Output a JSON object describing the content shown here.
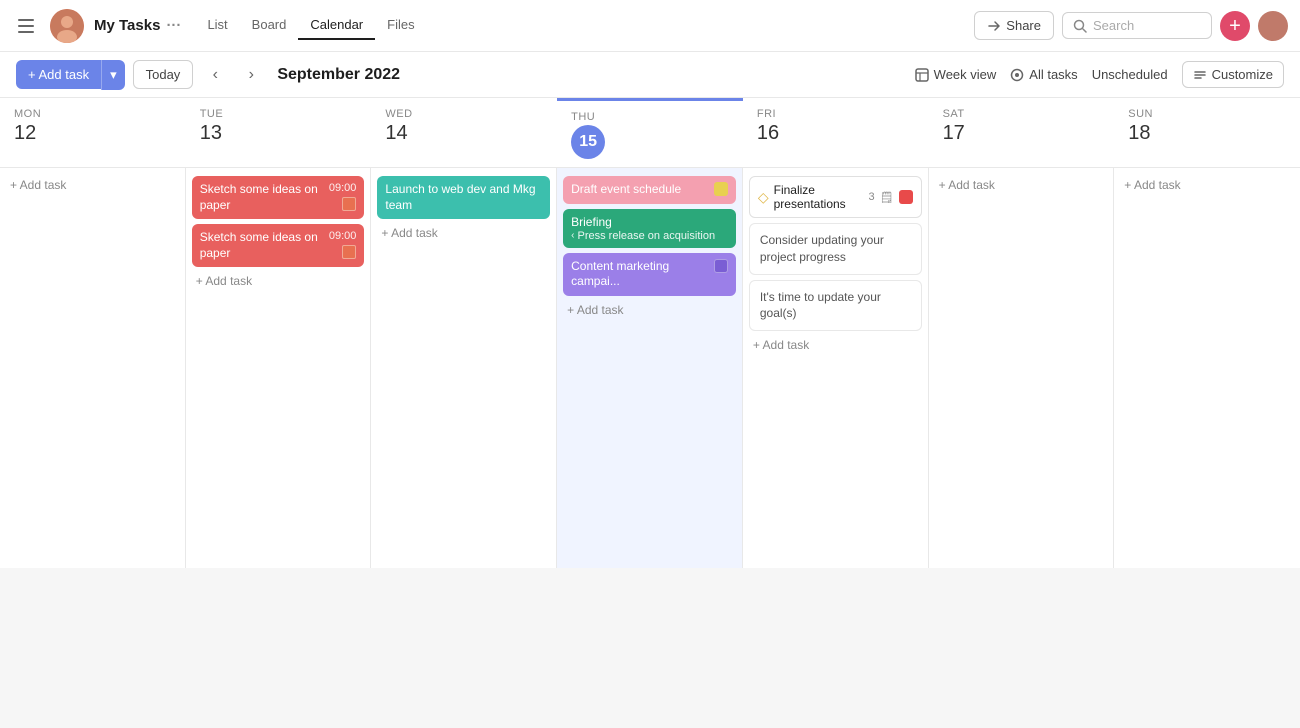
{
  "nav": {
    "hamburger_icon": "☰",
    "page_title": "My Tasks",
    "chevron_icon": "···",
    "tabs": [
      {
        "label": "List",
        "active": false
      },
      {
        "label": "Board",
        "active": false
      },
      {
        "label": "Calendar",
        "active": true
      },
      {
        "label": "Files",
        "active": false
      }
    ],
    "share_label": "Share",
    "search_placeholder": "Search",
    "plus_icon": "+",
    "lock_icon": "🔒"
  },
  "toolbar": {
    "add_task_label": "+ Add task",
    "dropdown_icon": "▾",
    "today_label": "Today",
    "prev_icon": "‹",
    "next_icon": "›",
    "month_title": "September 2022",
    "week_view_label": "Week view",
    "all_tasks_label": "All tasks",
    "unscheduled_label": "Unscheduled",
    "customize_label": "Customize"
  },
  "days": [
    {
      "name": "MON",
      "num": "12",
      "today": false
    },
    {
      "name": "TUE",
      "num": "13",
      "today": false
    },
    {
      "name": "WED",
      "num": "14",
      "today": false
    },
    {
      "name": "THU",
      "num": "15",
      "today": true
    },
    {
      "name": "FRI",
      "num": "16",
      "today": false
    },
    {
      "name": "SAT",
      "num": "17",
      "today": false
    },
    {
      "name": "SUN",
      "num": "18",
      "today": false
    }
  ],
  "tasks": {
    "mon": {
      "add_task": "+ Add task"
    },
    "tue": {
      "task1": {
        "text": "Sketch some ideas on paper",
        "time": "09:00",
        "color": "red"
      },
      "task2": {
        "text": "Sketch some ideas on paper",
        "time": "09:00",
        "color": "red"
      },
      "add_task": "+ Add task"
    },
    "wed": {
      "task1": {
        "text": "Launch to web dev and Mkg team",
        "color": "teal"
      },
      "add_task": "+ Add task"
    },
    "thu": {
      "task1": {
        "text": "Draft event schedule",
        "color": "pink-light"
      },
      "task2_main": "Briefing",
      "task2_sub": "‹ Press release on acquisition",
      "task3": {
        "text": "Content marketing campai...",
        "color": "purple"
      },
      "add_task": "+ Add task"
    },
    "fri": {
      "task1": {
        "text": "Finalize presentations",
        "badge": "3",
        "badge_icon": "📋"
      },
      "task2": {
        "text": "Consider updating your project progress"
      },
      "task3": {
        "text": "It's time to update your goal(s)"
      },
      "add_task": "+ Add task"
    },
    "sat": {
      "add_task": "+ Add task"
    },
    "sun": {
      "add_task": "+ Add task"
    }
  }
}
